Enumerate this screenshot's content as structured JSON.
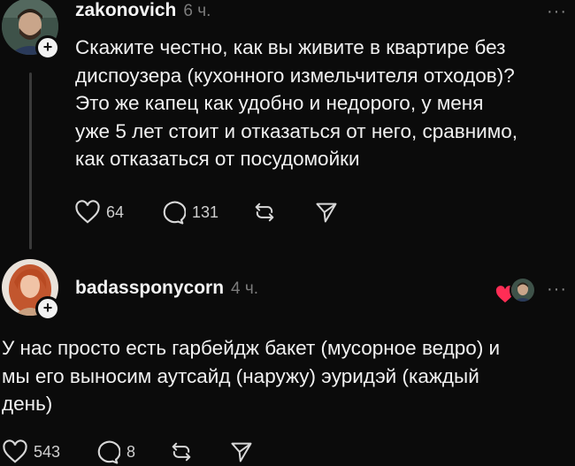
{
  "post": {
    "username": "zakonovich",
    "time": "6 ч.",
    "text_lines": [
      "Скажите честно, как вы живите в квартире без",
      "диспоузера (кухонного измельчителя отходов)?",
      "Это же капец как удобно и недорого, у меня",
      "уже 5 лет стоит и отказаться от него, сравнимо,",
      "как отказаться от посудомойки"
    ],
    "likes": "64",
    "comments": "131",
    "plus_label": "+",
    "more_label": "···"
  },
  "reply": {
    "username": "badassponycorn",
    "time": "4 ч.",
    "text_lines": [
      "У нас просто есть гарбейдж бакет (мусорное ведро) и",
      "мы его выносим аутсайд (наружу) эуридэй (каждый",
      "день)"
    ],
    "likes": "543",
    "comments": "8",
    "plus_label": "+",
    "more_label": "···"
  },
  "colors": {
    "background": "#0b0b0b",
    "text": "#f3f3f3",
    "muted": "#7b7b7b",
    "liked_heart": "#ff2d55"
  },
  "icons": {
    "like": "heart-outline-icon",
    "comment": "speech-bubble-icon",
    "repost": "repost-arrows-icon",
    "share": "paper-plane-icon",
    "author_liked": "red-heart-icon"
  }
}
